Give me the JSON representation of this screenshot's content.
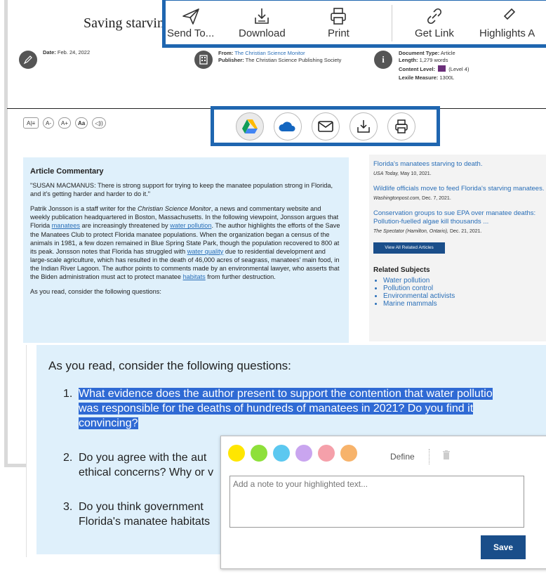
{
  "article": {
    "title": "Saving starvin",
    "date_label": "Date:",
    "date": "Feb. 24, 2022",
    "from_label": "From:",
    "from": "The Christian Science Monitor",
    "publisher_label": "Publisher:",
    "publisher": "The Christian Science Publishing Society",
    "doc_type_label": "Document Type:",
    "doc_type": "Article",
    "length_label": "Length:",
    "length": "1,279 words",
    "content_level_label": "Content Level:",
    "content_level": "(Level 4)",
    "lexile_label": "Lexile Measure:",
    "lexile": "1300L"
  },
  "text_tools": [
    "A|≡",
    "A-",
    "A+",
    "Aa",
    "◁))"
  ],
  "toolbar": {
    "items": [
      "Send To...",
      "Download",
      "Print",
      "Get Link",
      "Highlights A"
    ]
  },
  "share": {
    "buttons": [
      "google-drive",
      "onedrive",
      "email",
      "download",
      "print"
    ]
  },
  "commentary": {
    "heading": "Article Commentary",
    "quote": "\"SUSAN MACMANUS: There is strong support for trying to keep the manatee population strong in Florida, and it's getting harder and harder to do it.\"",
    "p_part1": "Patrik Jonsson is a staff writer for the ",
    "p_italic": "Christian Science Monitor",
    "p_part2": ", a news and commentary website and weekly publication headquartered in Boston, Massachusetts. In the following viewpoint, Jonsson argues that Florida ",
    "link_manatees": "manatees",
    "p_part3": " are increasingly threatened by ",
    "link_water_pollution": "water pollution",
    "p_part4": ". The author highlights the efforts of the Save the Manatees Club to protect Florida manatee populations. When the organization began a census of the animals in 1981, a few dozen remained in Blue Spring State Park, though the population recovered to 800 at its peak. Jonsson notes that Florida has struggled with ",
    "link_water_quality": "water quality",
    "p_part5": " due to residential development and large-scale agriculture, which has resulted in the death of 46,000 acres of seagrass, manatees' main food, in the Indian River Lagoon. The author points to comments made by an environmental lawyer, who asserts that the Biden administration must act to protect manatee ",
    "link_habitats": "habitats",
    "p_part6": " from further destruction.",
    "consider": "As you read, consider the following questions:"
  },
  "sidebar": {
    "articles": [
      {
        "title": "Florida's manatees starving to death.",
        "source": "USA Today,",
        "date": " May 10, 2021."
      },
      {
        "title": "Wildlife officials move to feed Florida's starving manatees.",
        "source": "Washingtonpost.com,",
        "date": " Dec. 7, 2021."
      },
      {
        "title": "Conservation groups to sue EPA over manatee deaths: Pollution-fuelled algae kill thousands ...",
        "source": "The Spectator (Hamilton, Ontario),",
        "date": " Dec. 21, 2021."
      }
    ],
    "view_all": "View All Related Articles",
    "subjects_heading": "Related Subjects",
    "subjects": [
      "Water pollution",
      "Pollution control",
      "Environmental activists",
      "Marine mammals"
    ]
  },
  "zoom": {
    "heading": "As you read, consider the following questions:",
    "q1_num": "1.",
    "q1_line1": "What evidence does the author present to support the contention that water pollutio",
    "q1_line2": "was responsible for the deaths of hundreds of manatees in 2021? Do you find it",
    "q1_line3": "convincing?",
    "q2_num": "2.",
    "q2_line1": "Do you agree with the aut",
    "q2_line2": "ethical concerns? Why or v",
    "q3_num": "3.",
    "q3_line1": "Do you think government",
    "q3_line2": "Florida's manatee habitats"
  },
  "highlight_popup": {
    "colors": [
      "#ffe600",
      "#8ee03a",
      "#5cc8f0",
      "#c9a5ef",
      "#f5a0aa",
      "#f7b36b"
    ],
    "define_label": "Define",
    "note_placeholder": "Add a note to your highlighted text...",
    "save_label": "Save"
  }
}
